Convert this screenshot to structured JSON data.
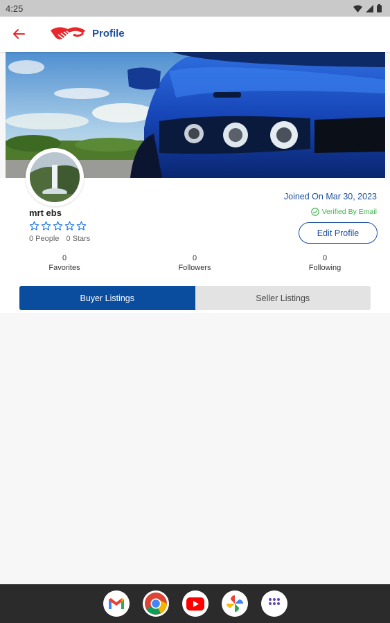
{
  "status_bar": {
    "time": "4:25"
  },
  "app_bar": {
    "title": "Profile"
  },
  "profile": {
    "name": "mrt ebs",
    "people": "0 People",
    "stars": "0 Stars",
    "rating": 0,
    "max_rating": 5,
    "joined": "Joined On Mar 30, 2023",
    "verified": "Verified By Email",
    "edit_button": "Edit Profile"
  },
  "stats": [
    {
      "count": "0",
      "label": "Favorites"
    },
    {
      "count": "0",
      "label": "Followers"
    },
    {
      "count": "0",
      "label": "Following"
    }
  ],
  "tabs": [
    {
      "label": "Buyer Listings",
      "active": true
    },
    {
      "label": "Seller Listings",
      "active": false
    }
  ],
  "dock": [
    "gmail-icon",
    "chrome-icon",
    "youtube-icon",
    "photos-icon",
    "app-drawer-icon"
  ],
  "colors": {
    "brand_blue": "#1a4f9c",
    "tab_active": "#0a4d9e",
    "brand_red": "#e8262b",
    "verified_green": "#39b54a"
  }
}
